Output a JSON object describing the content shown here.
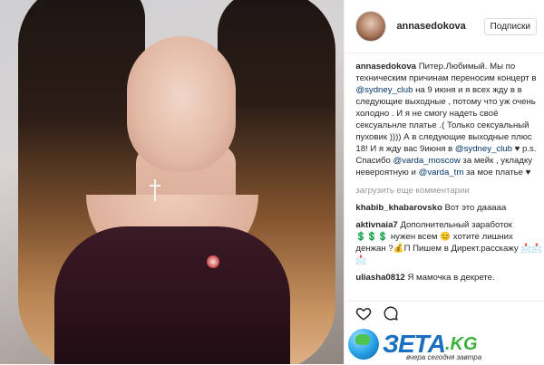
{
  "header": {
    "username": "annasedokova",
    "follow_label": "Подписки"
  },
  "caption": {
    "author": "annasedokova",
    "part1": "Питер.Любимый. Мы по техническим причинам переносим концерт в",
    "mention1": "@sydney_club",
    "part2": "на 9 июня и я всех жду в в следующие выходные , потому что уж очень холодно . И я не смогу надеть своё сексуальнле платье .( Только сексуальный пуховик )))) А в следующие выходные плюс 18! И я жду вас 9июня в",
    "mention2": "@sydney_club",
    "part3": "♥ p.s. Спасибо",
    "mention3": "@varda_moscow",
    "part4": "за мейк , укладку невероятную и",
    "mention4": "@varda_tm",
    "part5": "за мое платье ♥"
  },
  "load_more": "загрузить еще комментарии",
  "comments": [
    {
      "user": "khabib_khabarovsko",
      "text": "Вот это дааааа"
    },
    {
      "user": "aktivnaia7",
      "text": "Дополнительный заработок 💲💲💲 нужен всем 😊 хотите лишних денжан ?💰П Пишем в Директ.расскажу 📩📩📩"
    },
    {
      "user": "uliasha0812",
      "text": "Я мамочка в декрете."
    }
  ],
  "watermark": {
    "brand": "ЗЕТА",
    "domain": ".KG",
    "tagline": "вчера сегодня завтра"
  },
  "icons": [
    "heart-icon",
    "comment-icon"
  ],
  "colors": {
    "link": "#003569",
    "brand_blue": "#1b6fc1",
    "brand_green": "#3fb13f"
  }
}
